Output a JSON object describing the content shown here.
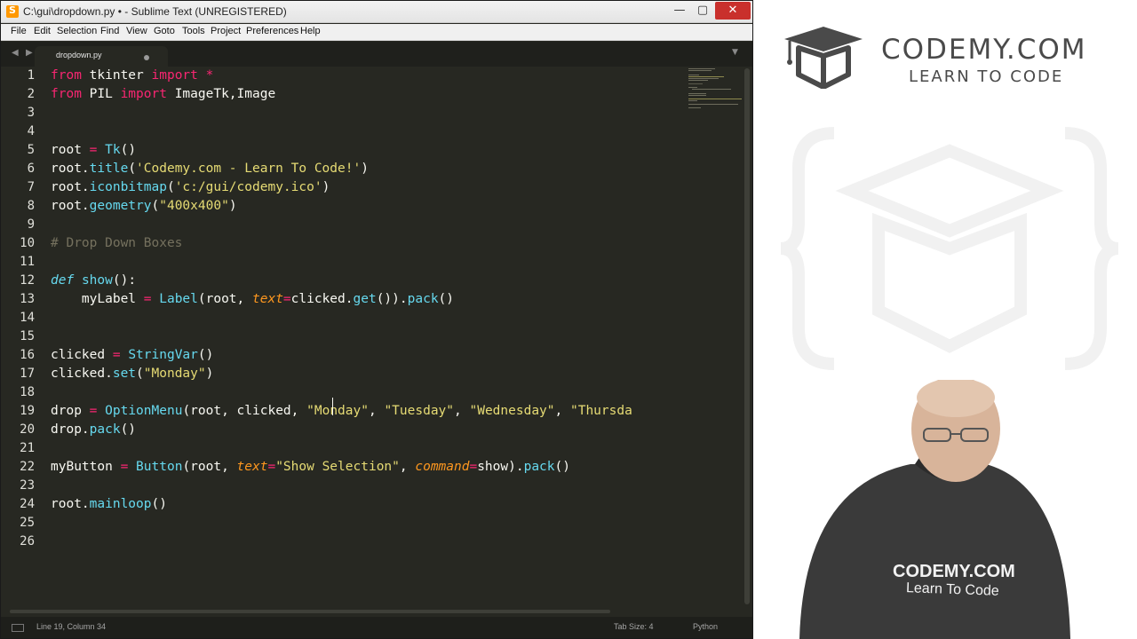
{
  "window": {
    "title": "C:\\gui\\dropdown.py • - Sublime Text (UNREGISTERED)",
    "minimize": "—",
    "maximize": "▢",
    "close": "✕"
  },
  "menu": [
    "File",
    "Edit",
    "Selection",
    "Find",
    "View",
    "Goto",
    "Tools",
    "Project",
    "Preferences",
    "Help"
  ],
  "tabs": {
    "nav_left": "◀",
    "nav_right": "▶",
    "active_tab": "dropdown.py",
    "dropdown": "▼"
  },
  "editor": {
    "line_numbers": [
      "1",
      "2",
      "3",
      "4",
      "5",
      "6",
      "7",
      "8",
      "9",
      "10",
      "11",
      "12",
      "13",
      "14",
      "15",
      "16",
      "17",
      "18",
      "19",
      "20",
      "21",
      "22",
      "23",
      "24",
      "25",
      "26"
    ],
    "lines": {
      "l1": [
        {
          "t": "from",
          "c": "k"
        },
        {
          "t": " tkinter ",
          "c": ""
        },
        {
          "t": "import",
          "c": "k"
        },
        {
          "t": " ",
          "c": ""
        },
        {
          "t": "*",
          "c": "k"
        }
      ],
      "l2": [
        {
          "t": "from",
          "c": "k"
        },
        {
          "t": " PIL ",
          "c": ""
        },
        {
          "t": "import",
          "c": "k"
        },
        {
          "t": " ImageTk,Image",
          "c": ""
        }
      ],
      "l5": [
        {
          "t": "root ",
          "c": ""
        },
        {
          "t": "=",
          "c": "k"
        },
        {
          "t": " ",
          "c": ""
        },
        {
          "t": "Tk",
          "c": "f"
        },
        {
          "t": "()",
          "c": ""
        }
      ],
      "l6": [
        {
          "t": "root.",
          "c": ""
        },
        {
          "t": "title",
          "c": "f"
        },
        {
          "t": "(",
          "c": ""
        },
        {
          "t": "'Codemy.com - Learn To Code!'",
          "c": "s"
        },
        {
          "t": ")",
          "c": ""
        }
      ],
      "l7": [
        {
          "t": "root.",
          "c": ""
        },
        {
          "t": "iconbitmap",
          "c": "f"
        },
        {
          "t": "(",
          "c": ""
        },
        {
          "t": "'c:/gui/codemy.ico'",
          "c": "s"
        },
        {
          "t": ")",
          "c": ""
        }
      ],
      "l8": [
        {
          "t": "root.",
          "c": ""
        },
        {
          "t": "geometry",
          "c": "f"
        },
        {
          "t": "(",
          "c": ""
        },
        {
          "t": "\"400x400\"",
          "c": "s"
        },
        {
          "t": ")",
          "c": ""
        }
      ],
      "l10": [
        {
          "t": "# Drop Down Boxes",
          "c": "c"
        }
      ],
      "l12": [
        {
          "t": "def",
          "c": "kd"
        },
        {
          "t": " ",
          "c": ""
        },
        {
          "t": "show",
          "c": "f"
        },
        {
          "t": "():",
          "c": ""
        }
      ],
      "l13": [
        {
          "t": "    myLabel ",
          "c": ""
        },
        {
          "t": "=",
          "c": "k"
        },
        {
          "t": " ",
          "c": ""
        },
        {
          "t": "Label",
          "c": "f"
        },
        {
          "t": "(root, ",
          "c": ""
        },
        {
          "t": "text",
          "c": "a"
        },
        {
          "t": "=",
          "c": "k"
        },
        {
          "t": "clicked.",
          "c": ""
        },
        {
          "t": "get",
          "c": "f"
        },
        {
          "t": "()).",
          "c": ""
        },
        {
          "t": "pack",
          "c": "f"
        },
        {
          "t": "()",
          "c": ""
        }
      ],
      "l16": [
        {
          "t": "clicked ",
          "c": ""
        },
        {
          "t": "=",
          "c": "k"
        },
        {
          "t": " ",
          "c": ""
        },
        {
          "t": "StringVar",
          "c": "f"
        },
        {
          "t": "()",
          "c": ""
        }
      ],
      "l17": [
        {
          "t": "clicked.",
          "c": ""
        },
        {
          "t": "set",
          "c": "f"
        },
        {
          "t": "(",
          "c": ""
        },
        {
          "t": "\"Monday\"",
          "c": "s"
        },
        {
          "t": ")",
          "c": ""
        }
      ],
      "l19": [
        {
          "t": "drop ",
          "c": ""
        },
        {
          "t": "=",
          "c": "k"
        },
        {
          "t": " ",
          "c": ""
        },
        {
          "t": "OptionMenu",
          "c": "f"
        },
        {
          "t": "(root, clicked, ",
          "c": ""
        },
        {
          "t": "\"Monday\"",
          "c": "s"
        },
        {
          "t": ", ",
          "c": ""
        },
        {
          "t": "\"Tuesday\"",
          "c": "s"
        },
        {
          "t": ", ",
          "c": ""
        },
        {
          "t": "\"Wednesday\"",
          "c": "s"
        },
        {
          "t": ", ",
          "c": ""
        },
        {
          "t": "\"Thursda",
          "c": "s"
        }
      ],
      "l20": [
        {
          "t": "drop.",
          "c": ""
        },
        {
          "t": "pack",
          "c": "f"
        },
        {
          "t": "()",
          "c": ""
        }
      ],
      "l22": [
        {
          "t": "myButton ",
          "c": ""
        },
        {
          "t": "=",
          "c": "k"
        },
        {
          "t": " ",
          "c": ""
        },
        {
          "t": "Button",
          "c": "f"
        },
        {
          "t": "(root, ",
          "c": ""
        },
        {
          "t": "text",
          "c": "a"
        },
        {
          "t": "=",
          "c": "k"
        },
        {
          "t": "\"Show Selection\"",
          "c": "s"
        },
        {
          "t": ", ",
          "c": ""
        },
        {
          "t": "command",
          "c": "a"
        },
        {
          "t": "=",
          "c": "k"
        },
        {
          "t": "show).",
          "c": ""
        },
        {
          "t": "pack",
          "c": "f"
        },
        {
          "t": "()",
          "c": ""
        }
      ],
      "l24": [
        {
          "t": "root.",
          "c": ""
        },
        {
          "t": "mainloop",
          "c": "f"
        },
        {
          "t": "()",
          "c": ""
        }
      ]
    }
  },
  "status": {
    "position": "Line 19, Column 34",
    "tab_size": "Tab Size: 4",
    "syntax": "Python"
  },
  "brand": {
    "name": "CODEMY.COM",
    "tagline": "LEARN TO CODE",
    "shirt_name": "CODEMY.COM",
    "shirt_tagline": "Learn To Code"
  },
  "icons": [
    "sublime-app-icon",
    "cube-logo-icon",
    "status-panel-icon"
  ]
}
